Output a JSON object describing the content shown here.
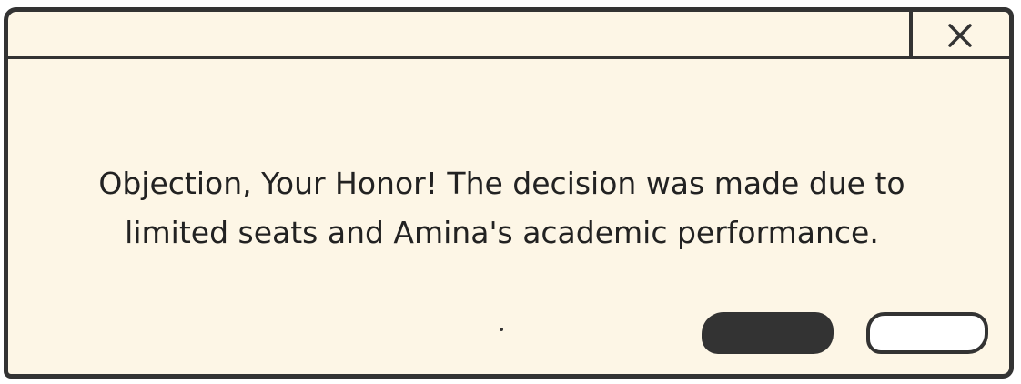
{
  "dialog": {
    "title": "",
    "message": "Objection, Your Honor! The decision was made due to\nlimited seats and Amina's academic performance.",
    "close_icon": "close-icon",
    "primary_button_label": "",
    "secondary_button_label": ""
  },
  "colors": {
    "background": "#fdf6e6",
    "outline": "#333333",
    "primary_button": "#333333",
    "secondary_button": "#ffffff",
    "text": "#222222"
  }
}
